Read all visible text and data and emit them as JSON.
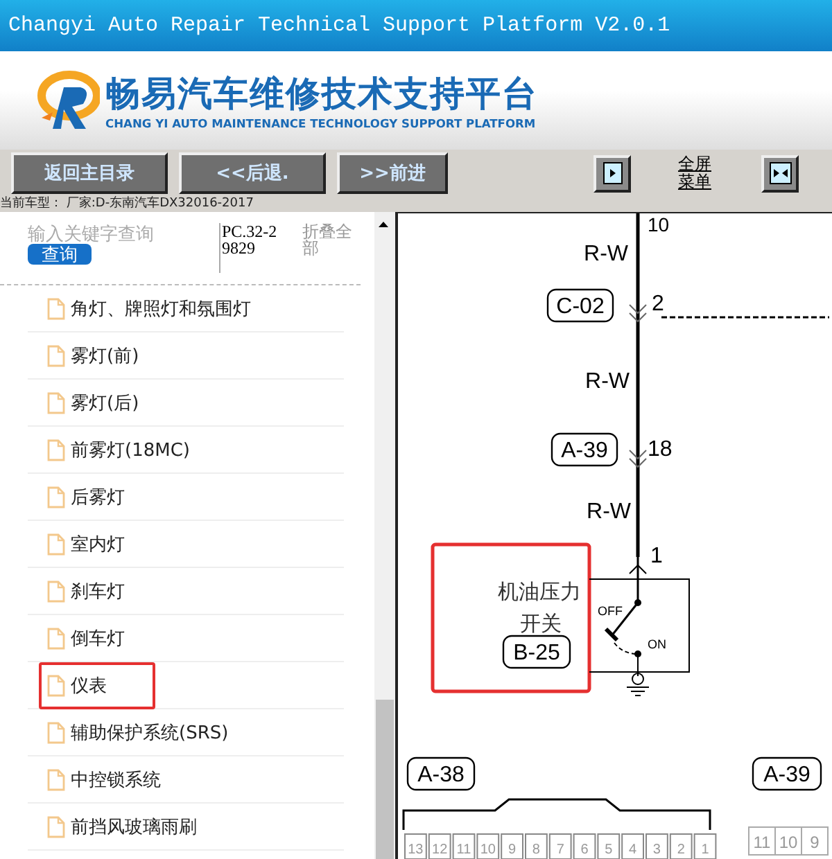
{
  "window": {
    "title": "Changyi Auto Repair Technical Support Platform V2.0.1"
  },
  "header": {
    "logo_title": "畅易汽车维修技术支持平台",
    "logo_subtitle": "CHANG YI AUTO MAINTENANCE TECHNOLOGY SUPPORT PLATFORM"
  },
  "toolbar": {
    "buttons": [
      "返回主目录",
      "<<后退.",
      ">>前进"
    ],
    "menu_toggle": "全屏菜单"
  },
  "vehicle_info": "当前车型：  厂家:D-东南汽车DX32016-2017",
  "sidebar": {
    "search": {
      "placeholder": "输入关键字查询",
      "button": "查询"
    },
    "code": "PC.32-29829",
    "collapse": "折叠全部",
    "items": [
      {
        "label": "角灯、牌照灯和氛围灯",
        "highlighted": false
      },
      {
        "label": "雾灯(前)",
        "highlighted": false
      },
      {
        "label": "雾灯(后)",
        "highlighted": false
      },
      {
        "label": "前雾灯(18MC)",
        "highlighted": false
      },
      {
        "label": "后雾灯",
        "highlighted": false
      },
      {
        "label": "室内灯",
        "highlighted": false
      },
      {
        "label": "刹车灯",
        "highlighted": false
      },
      {
        "label": "倒车灯",
        "highlighted": false
      },
      {
        "label": "仪表",
        "highlighted": true
      },
      {
        "label": "辅助保护系统(SRS)",
        "highlighted": false
      },
      {
        "label": "中控锁系统",
        "highlighted": false
      },
      {
        "label": "前挡风玻璃雨刷",
        "highlighted": false
      }
    ]
  },
  "diagram": {
    "top_pin": "10",
    "wire_labels": [
      "R-W",
      "R-W",
      "R-W"
    ],
    "connectors": [
      "C-02",
      "A-39"
    ],
    "pins": [
      "2",
      "18",
      "1"
    ],
    "component": {
      "line_1": "机油压力",
      "line_2": "开关",
      "code": "B-25",
      "off": "OFF",
      "on": "ON"
    },
    "bottom_connectors": [
      {
        "code": "A-38",
        "pins": [
          "13",
          "12",
          "11",
          "10",
          "9",
          "8",
          "7",
          "6",
          "5",
          "4",
          "3",
          "2",
          "1"
        ]
      },
      {
        "code": "A-39",
        "pins": [
          "11",
          "10",
          "9"
        ]
      }
    ]
  }
}
